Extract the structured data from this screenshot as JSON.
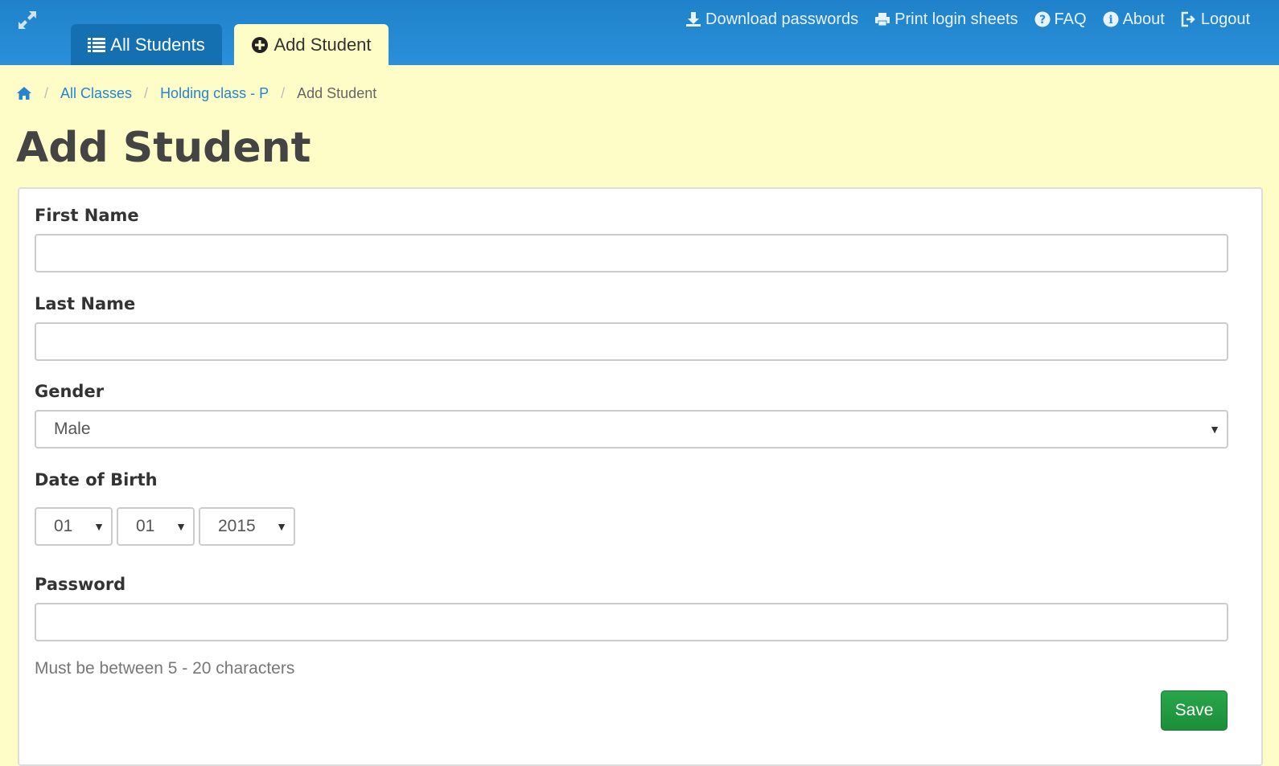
{
  "header": {
    "tabs": [
      {
        "label": "All Students",
        "icon": "list-icon",
        "active": false
      },
      {
        "label": "Add Student",
        "icon": "plus-circle-icon",
        "active": true
      }
    ],
    "nav": [
      {
        "label": "Download passwords",
        "icon": "download-icon"
      },
      {
        "label": "Print login sheets",
        "icon": "print-icon"
      },
      {
        "label": "FAQ",
        "icon": "question-circle-icon"
      },
      {
        "label": "About",
        "icon": "info-circle-icon"
      },
      {
        "label": "Logout",
        "icon": "logout-icon"
      }
    ]
  },
  "breadcrumb": {
    "items": [
      {
        "label": "All Classes"
      },
      {
        "label": "Holding class - P"
      },
      {
        "label": "Add Student"
      }
    ]
  },
  "page": {
    "title": "Add Student"
  },
  "form": {
    "first_name": {
      "label": "First Name",
      "value": ""
    },
    "last_name": {
      "label": "Last Name",
      "value": ""
    },
    "gender": {
      "label": "Gender",
      "value": "Male"
    },
    "dob": {
      "label": "Date of Birth",
      "day": "01",
      "month": "01",
      "year": "2015"
    },
    "password": {
      "label": "Password",
      "value": "",
      "help": "Must be between 5 - 20 characters"
    },
    "save_label": "Save"
  },
  "colors": {
    "header_blue": "#2a90d9",
    "active_tab_bg": "#fffdc7",
    "page_bg": "#fffdc7",
    "link_blue": "#2386ce",
    "save_green": "#28a64b"
  }
}
